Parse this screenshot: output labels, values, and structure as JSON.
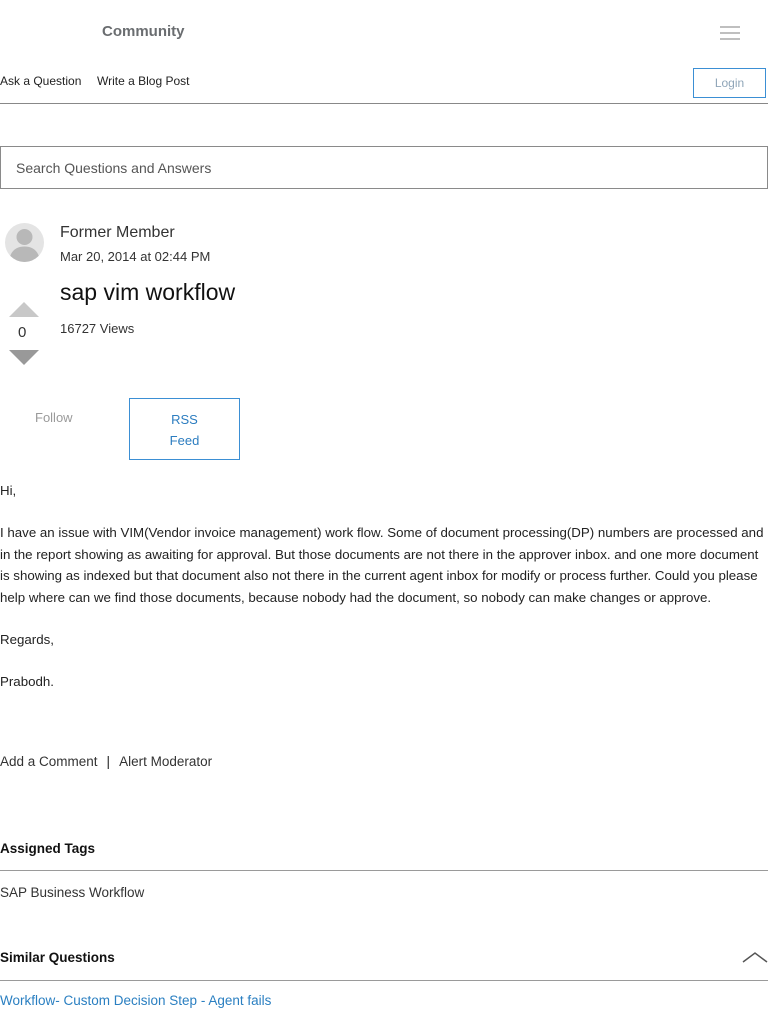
{
  "header": {
    "brand": "Community",
    "nav": [
      "Ask a Question",
      "Write a Blog Post"
    ],
    "login_label": "Login"
  },
  "search": {
    "placeholder": "Search Questions and Answers"
  },
  "question": {
    "author": "Former Member",
    "date": "Mar 20, 2014 at 02:44 PM",
    "title": "sap vim workflow",
    "views": "16727 Views",
    "vote_count": "0",
    "follow_label": "Follow",
    "rss_label_1": "RSS",
    "rss_label_2": "Feed",
    "body": [
      "Hi,",
      "I have an issue with VIM(Vendor invoice management) work flow. Some of document processing(DP) numbers are processed and in the report showing as awaiting for approval. But those documents are not there in the approver inbox. and one more document is showing as indexed but that document also not there in the current agent inbox for modify or process further. Could you please help where can we find those documents, because nobody had the document, so nobody can make changes or approve.",
      "Regards,",
      "Prabodh."
    ],
    "actions": {
      "comment": "Add a Comment",
      "separator": "|",
      "alert": "Alert Moderator"
    }
  },
  "assigned_tags": {
    "heading": "Assigned Tags",
    "tags": [
      "SAP Business Workflow"
    ]
  },
  "similar_questions": {
    "heading": "Similar Questions",
    "items": [
      "Workflow- Custom Decision Step - Agent fails"
    ]
  },
  "icons": {
    "menu": "hamburger-menu-icon",
    "avatar": "user-avatar-icon",
    "collapse": "chevron-up-icon"
  },
  "colors": {
    "accent": "#2a7fc1",
    "login_border": "#3b8fd4"
  }
}
